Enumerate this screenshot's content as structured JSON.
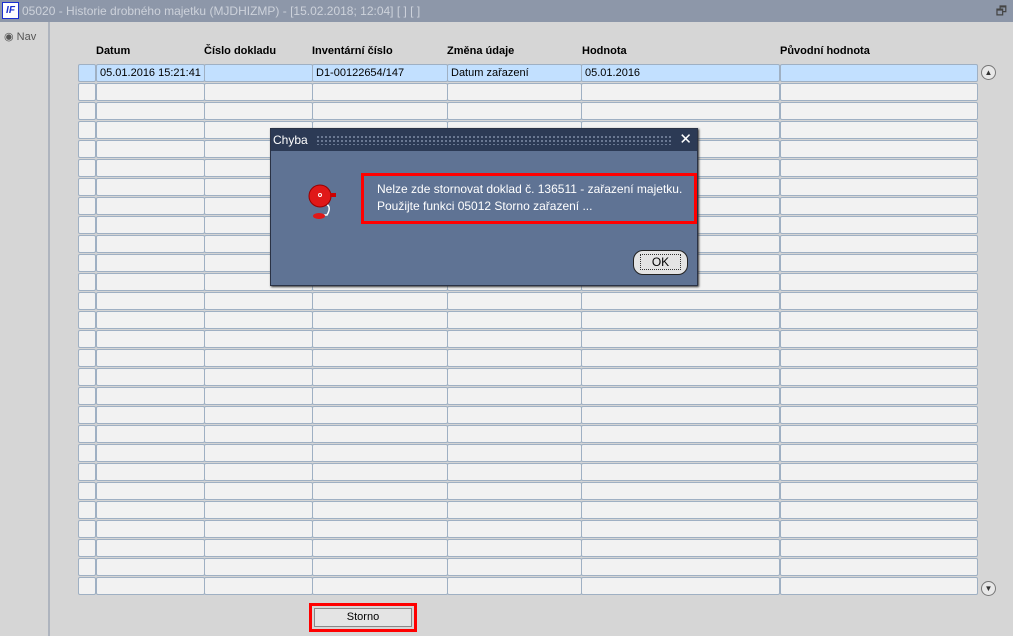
{
  "window": {
    "logo": "IF",
    "title": "05020 - Historie drobného majetku (MJDHIZMP) - [15.02.2018; 12:04]  [ ]  [ ]",
    "restore_icon": "restore-icon"
  },
  "nav": {
    "label": "Nav"
  },
  "table": {
    "headers": [
      "Datum",
      "Číslo dokladu",
      "Inventární číslo",
      "Změna údaje",
      "Hodnota",
      "Původní hodnota"
    ],
    "rows": [
      {
        "datum": "05.01.2016 15:21:41",
        "cislo_dokladu": "",
        "inventarni_cislo": "D1-00122654/147",
        "zmena_udaje": "Datum zařazení",
        "hodnota": "05.01.2016",
        "puvodni_hodnota": ""
      }
    ],
    "empty_rows": 27
  },
  "buttons": {
    "storno": "Storno"
  },
  "dialog": {
    "title": "Chyba",
    "line1": "Nelze zde stornovat doklad č. 136511 - zařazení majetku.",
    "line2": "Použijte funkci 05012 Storno zařazení ...",
    "ok": "OK"
  }
}
